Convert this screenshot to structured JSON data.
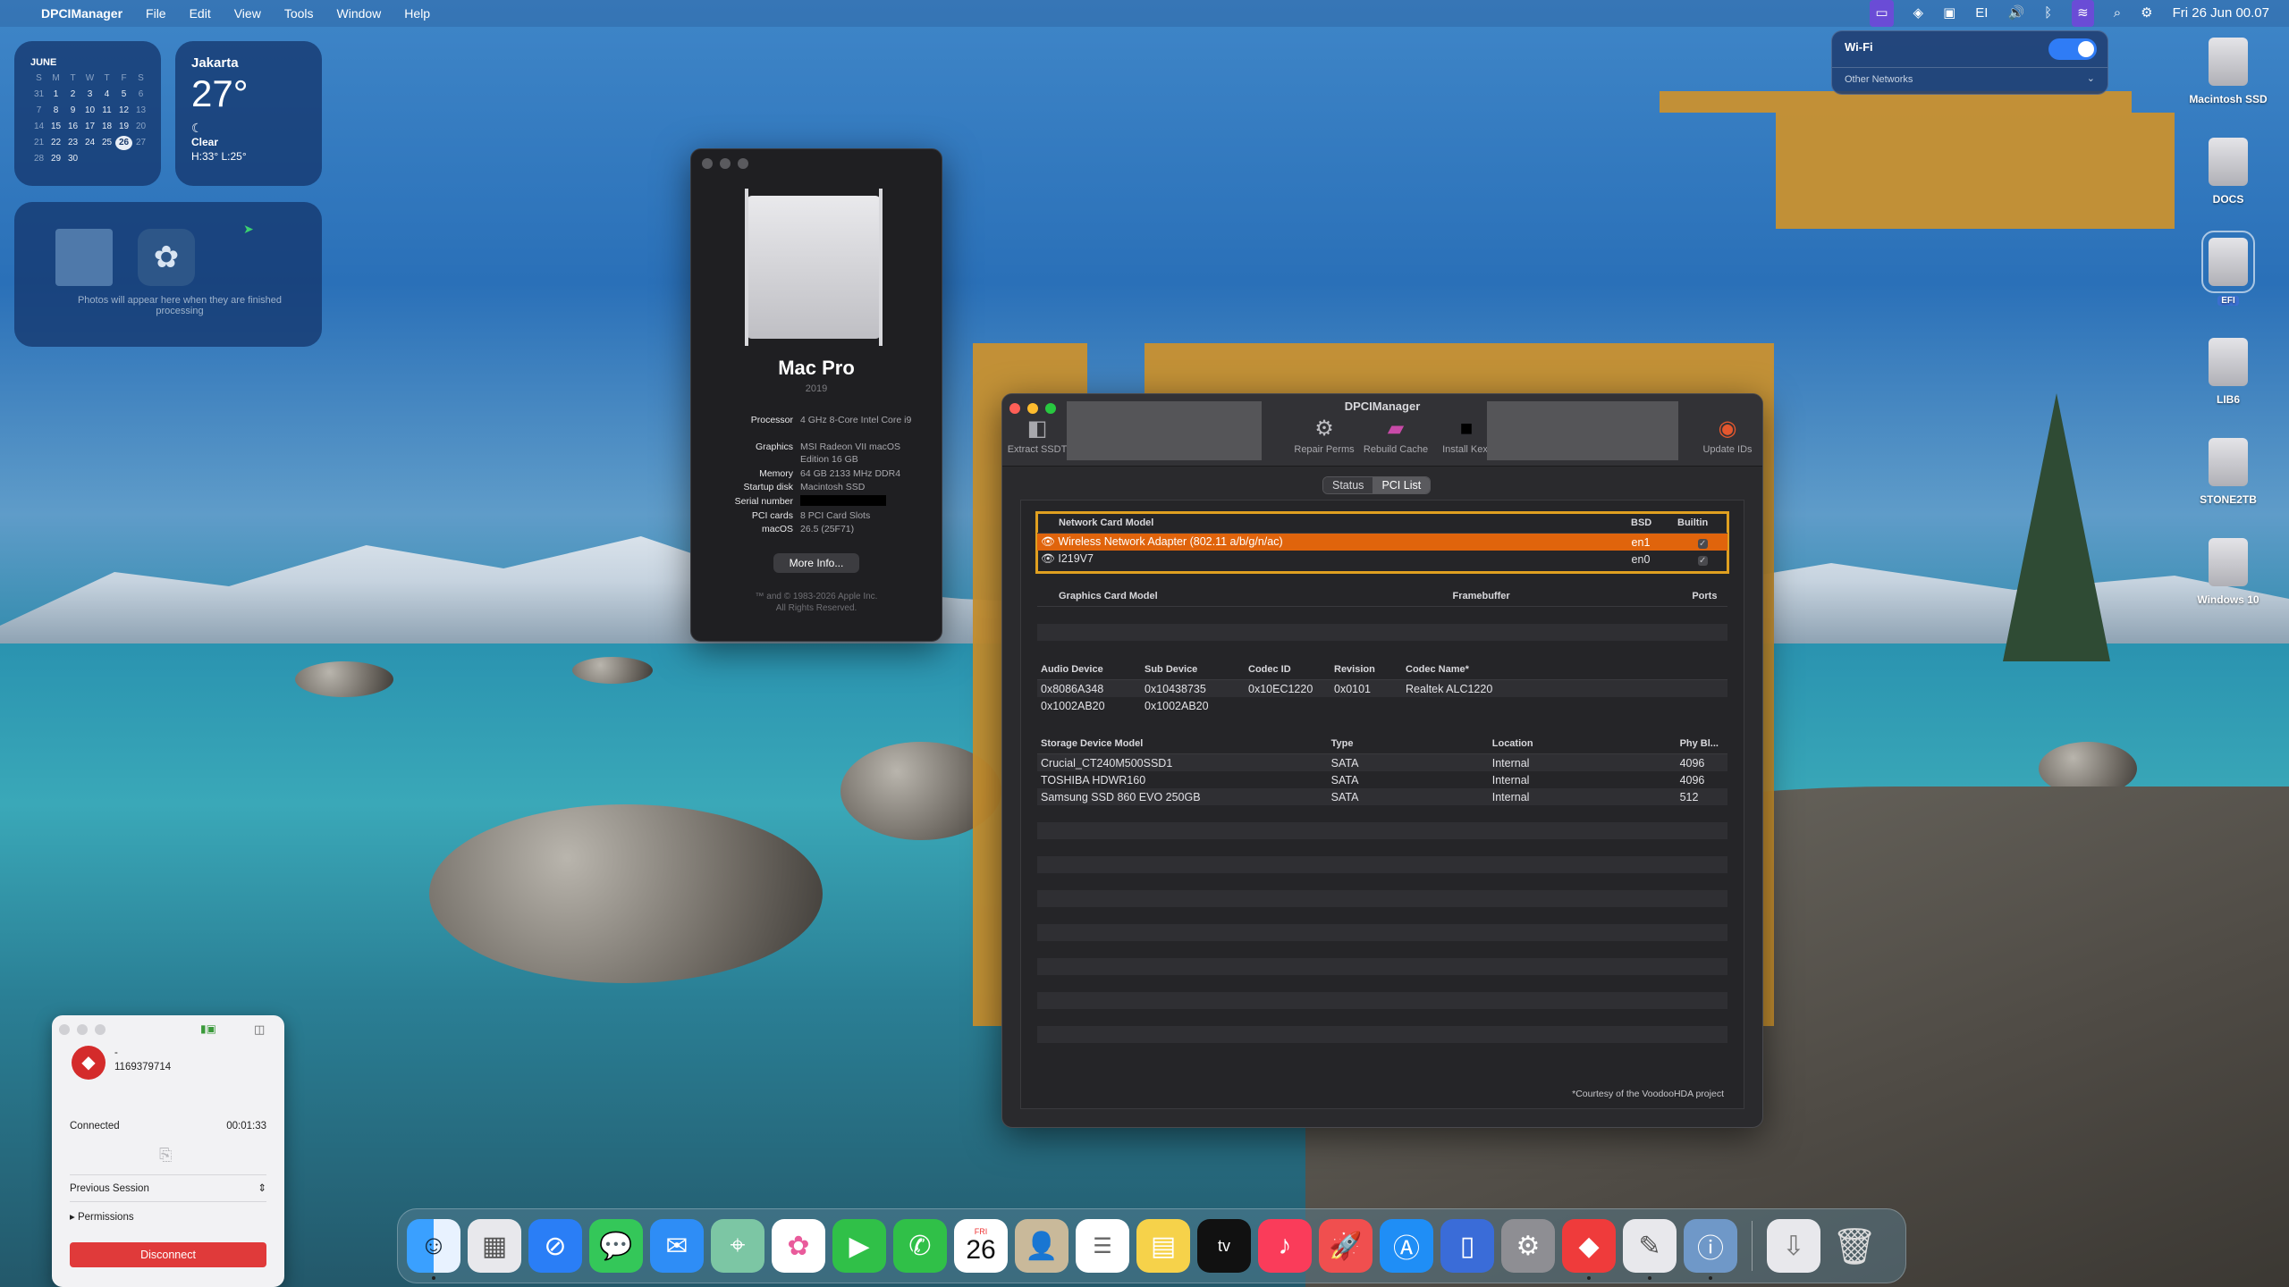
{
  "menubar": {
    "apple_icon": "",
    "app_name": "DPCIManager",
    "menus": [
      "File",
      "Edit",
      "View",
      "Tools",
      "Window",
      "Help"
    ],
    "status_input": "EI",
    "clock": "Fri 26 Jun  00.07"
  },
  "calendar_widget": {
    "month": "JUNE",
    "weekdays": [
      "S",
      "M",
      "T",
      "W",
      "T",
      "F",
      "S"
    ],
    "days": [
      [
        "31",
        "1",
        "2",
        "3",
        "4",
        "5",
        "6"
      ],
      [
        "7",
        "8",
        "9",
        "10",
        "11",
        "12",
        "13"
      ],
      [
        "14",
        "15",
        "16",
        "17",
        "18",
        "19",
        "20"
      ],
      [
        "21",
        "22",
        "23",
        "24",
        "25",
        "26",
        "27"
      ],
      [
        "28",
        "29",
        "30",
        "",
        "",
        "",
        ""
      ]
    ],
    "today": "26"
  },
  "weather_widget": {
    "city": "Jakarta",
    "temp": "27°",
    "condition": "Clear",
    "high_low": "H:33° L:25°"
  },
  "photos_widget": {
    "note": "Photos will appear here when they are finished processing"
  },
  "about_mac": {
    "model": "Mac Pro",
    "year": "2019",
    "specs": [
      {
        "k": "Processor",
        "v": "4 GHz 8-Core Intel Core i9"
      },
      {
        "k": "Graphics",
        "v": "MSI Radeon VII macOS Edition 16 GB"
      },
      {
        "k": "Memory",
        "v": "64 GB 2133 MHz DDR4"
      },
      {
        "k": "Startup disk",
        "v": "Macintosh SSD"
      },
      {
        "k": "Serial number",
        "v": ""
      },
      {
        "k": "PCI cards",
        "v": "8 PCI Card Slots"
      },
      {
        "k": "macOS",
        "v": "26.5 (25F71)"
      }
    ],
    "more_info": "More Info...",
    "copyright": "™ and © 1983-2026 Apple Inc.\nAll Rights Reserved."
  },
  "dpci": {
    "title": "DPCIManager",
    "tools": {
      "extract": "Extract SSDT",
      "repair": "Repair Perms",
      "rebuild": "Rebuild Cache",
      "install": "Install Kext",
      "update": "Update IDs"
    },
    "tabs": [
      "Status",
      "PCI List"
    ],
    "active_tab": "PCI List",
    "network": {
      "headers": [
        "Network Card Model",
        "BSD",
        "Builtin"
      ],
      "rows": [
        {
          "model": "Wireless Network Adapter (802.11 a/b/g/n/ac)",
          "bsd": "en1",
          "builtin": "✓"
        },
        {
          "model": "I219V7",
          "bsd": "en0",
          "builtin": "✓"
        }
      ]
    },
    "graphics": {
      "headers": [
        "Graphics Card Model",
        "Framebuffer",
        "Ports"
      ]
    },
    "audio": {
      "headers": [
        "Audio Device",
        "Sub Device",
        "Codec ID",
        "Revision",
        "Codec Name*"
      ],
      "rows": [
        [
          "0x8086A348",
          "0x10438735",
          "0x10EC1220",
          "0x0101",
          "Realtek ALC1220"
        ],
        [
          "0x1002AB20",
          "0x1002AB20",
          "",
          "",
          ""
        ]
      ]
    },
    "storage": {
      "headers": [
        "Storage Device Model",
        "Type",
        "Location",
        "Phy Bl..."
      ],
      "rows": [
        [
          "Crucial_CT240M500SSD1",
          "SATA",
          "Internal",
          "4096"
        ],
        [
          "TOSHIBA HDWR160",
          "SATA",
          "Internal",
          "4096"
        ],
        [
          "Samsung SSD 860 EVO 250GB",
          "SATA",
          "Internal",
          "512"
        ]
      ]
    },
    "footnote": "*Courtesy of the VoodooHDA project"
  },
  "wifi_panel": {
    "title": "Wi-Fi",
    "other": "Other Networks",
    "enabled": true
  },
  "desktop_drives": [
    {
      "label": "Macintosh SSD"
    },
    {
      "label": "DOCS"
    },
    {
      "label": "EFI"
    },
    {
      "label": "LIB6"
    },
    {
      "label": "STONE2TB"
    },
    {
      "label": "Windows 10"
    }
  ],
  "remote": {
    "dash": "-",
    "id": "1169379714",
    "status": "Connected",
    "timer": "00:01:33",
    "session": "Previous Session",
    "permissions": "Permissions",
    "disconnect": "Disconnect"
  },
  "dock": {
    "calendar_day": "26",
    "calendar_weekday": "FRI",
    "tv_label": "tv"
  }
}
